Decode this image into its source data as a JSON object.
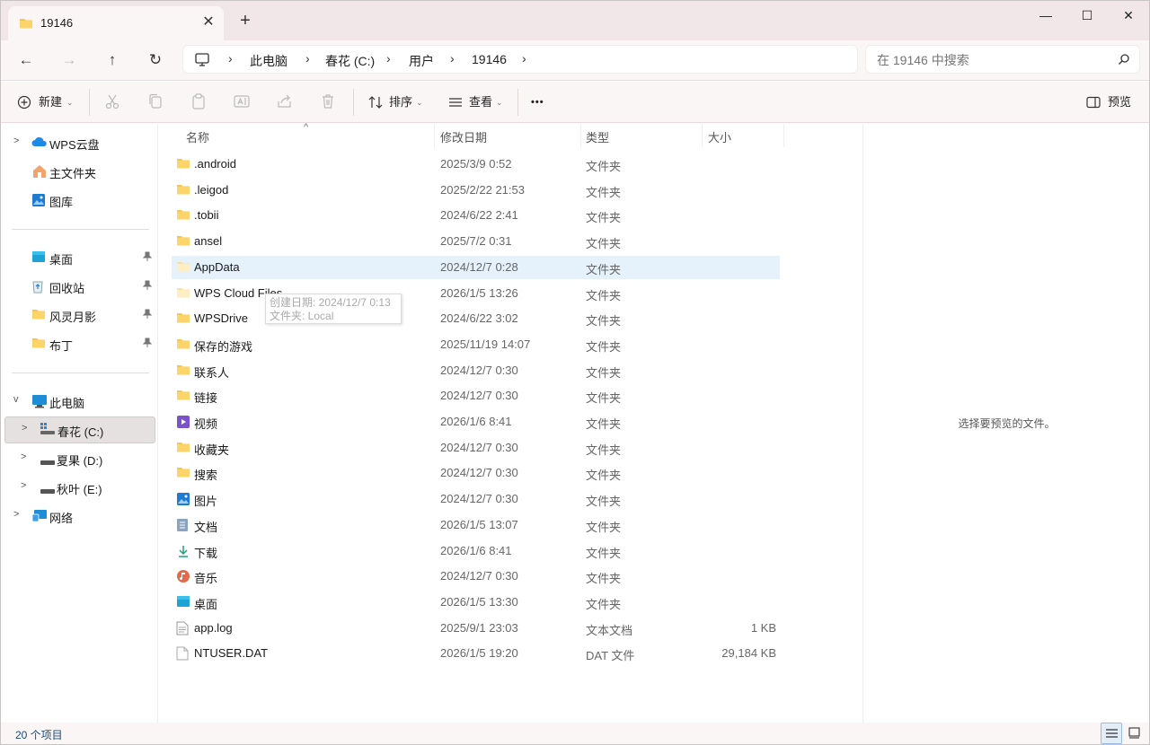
{
  "tab": {
    "title": "19146",
    "close_glyph": "✕",
    "new_glyph": "+"
  },
  "window_controls": {
    "minimize": "—",
    "maximize": "☐",
    "close": "✕"
  },
  "nav": {
    "back_glyph": "←",
    "forward_glyph": "→",
    "up_glyph": "↑",
    "refresh_glyph": "↻",
    "breadcrumb": [
      "此电脑",
      "春花 (C:)",
      "用户",
      "19146"
    ],
    "separator": "›",
    "search_placeholder": "在 19146 中搜索"
  },
  "toolbar": {
    "new_label": "新建",
    "sort_label": "排序",
    "view_label": "查看",
    "more_label": "•••",
    "preview_label": "预览",
    "icons": [
      "cut-icon",
      "copy-icon",
      "paste-icon",
      "rename-icon",
      "share-icon",
      "delete-icon"
    ]
  },
  "sidebar": {
    "top_items": [
      {
        "label": "WPS云盘",
        "icon": "cloud-icon",
        "expandable": true
      },
      {
        "label": "主文件夹",
        "icon": "home-icon",
        "expandable": false
      },
      {
        "label": "图库",
        "icon": "gallery-icon",
        "expandable": false
      }
    ],
    "pinned": [
      {
        "label": "桌面",
        "icon": "desktop-icon"
      },
      {
        "label": "回收站",
        "icon": "recycle-bin-icon"
      },
      {
        "label": "风灵月影",
        "icon": "folder-icon"
      },
      {
        "label": "布丁",
        "icon": "folder-icon"
      }
    ],
    "this_pc": "此电脑",
    "drives": [
      {
        "label": "春花 (C:)",
        "selected": true
      },
      {
        "label": "夏果 (D:)",
        "selected": false
      },
      {
        "label": "秋叶 (E:)",
        "selected": false
      }
    ],
    "network": "网络"
  },
  "columns": {
    "name": "名称",
    "modified": "修改日期",
    "type": "类型",
    "size": "大小",
    "sort_glyph": "^"
  },
  "files": [
    {
      "name": ".android",
      "date": "2025/3/9 0:52",
      "type": "文件夹",
      "size": "",
      "icon": "folder-icon"
    },
    {
      "name": ".leigod",
      "date": "2025/2/22 21:53",
      "type": "文件夹",
      "size": "",
      "icon": "folder-icon"
    },
    {
      "name": ".tobii",
      "date": "2024/6/22 2:41",
      "type": "文件夹",
      "size": "",
      "icon": "folder-icon"
    },
    {
      "name": "ansel",
      "date": "2025/7/2 0:31",
      "type": "文件夹",
      "size": "",
      "icon": "folder-icon"
    },
    {
      "name": "AppData",
      "date": "2024/12/7 0:28",
      "type": "文件夹",
      "size": "",
      "icon": "folder-faded-icon"
    },
    {
      "name": "WPS Cloud Files",
      "date": "2026/1/5 13:26",
      "type": "文件夹",
      "size": "",
      "icon": "folder-faded-icon"
    },
    {
      "name": "WPSDrive",
      "date": "2024/6/22 3:02",
      "type": "文件夹",
      "size": "",
      "icon": "folder-icon"
    },
    {
      "name": "保存的游戏",
      "date": "2025/11/19 14:07",
      "type": "文件夹",
      "size": "",
      "icon": "folder-icon"
    },
    {
      "name": "联系人",
      "date": "2024/12/7 0:30",
      "type": "文件夹",
      "size": "",
      "icon": "folder-icon"
    },
    {
      "name": "链接",
      "date": "2024/12/7 0:30",
      "type": "文件夹",
      "size": "",
      "icon": "folder-icon"
    },
    {
      "name": "视频",
      "date": "2026/1/6 8:41",
      "type": "文件夹",
      "size": "",
      "icon": "video-icon"
    },
    {
      "name": "收藏夹",
      "date": "2024/12/7 0:30",
      "type": "文件夹",
      "size": "",
      "icon": "folder-icon"
    },
    {
      "name": "搜索",
      "date": "2024/12/7 0:30",
      "type": "文件夹",
      "size": "",
      "icon": "folder-icon"
    },
    {
      "name": "图片",
      "date": "2024/12/7 0:30",
      "type": "文件夹",
      "size": "",
      "icon": "pictures-icon"
    },
    {
      "name": "文档",
      "date": "2026/1/5 13:07",
      "type": "文件夹",
      "size": "",
      "icon": "documents-icon"
    },
    {
      "name": "下载",
      "date": "2026/1/6 8:41",
      "type": "文件夹",
      "size": "",
      "icon": "download-icon"
    },
    {
      "name": "音乐",
      "date": "2024/12/7 0:30",
      "type": "文件夹",
      "size": "",
      "icon": "music-icon"
    },
    {
      "name": "桌面",
      "date": "2026/1/5 13:30",
      "type": "文件夹",
      "size": "",
      "icon": "desktop-icon"
    },
    {
      "name": "app.log",
      "date": "2025/9/1 23:03",
      "type": "文本文档",
      "size": "1 KB",
      "icon": "text-file-icon"
    },
    {
      "name": "NTUSER.DAT",
      "date": "2026/1/5 19:20",
      "type": "DAT 文件",
      "size": "29,184 KB",
      "icon": "file-icon"
    }
  ],
  "hovered_index": 4,
  "tooltip": {
    "line1": "创建日期: 2024/12/7 0:13",
    "line2": "文件夹: Local"
  },
  "preview_message": "选择要预览的文件。",
  "status": {
    "count": "20 个项目"
  },
  "colors": {
    "accent": "#0067c0",
    "hover_row": "#e5f1fb",
    "folder": "#f8c64a",
    "titlebar": "#f2e7e8"
  }
}
